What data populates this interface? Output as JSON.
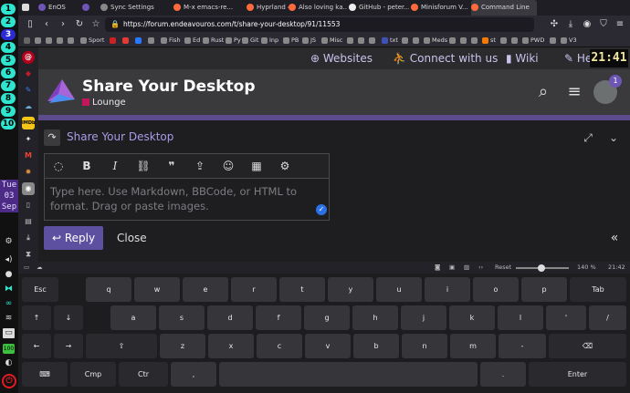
{
  "wm": {
    "workspaces": [
      "1",
      "2",
      "3",
      "4",
      "5",
      "6",
      "7",
      "8",
      "9",
      "10"
    ],
    "active_workspace": "3",
    "clock_lines": [
      "Tue",
      "03",
      "Sep"
    ]
  },
  "browser": {
    "tabs": [
      {
        "label": "EnOS",
        "color": "#6e56b7"
      },
      {
        "label": "",
        "color": "#6e56b7"
      },
      {
        "label": "Sync Settings",
        "color": "#888888"
      },
      {
        "label": "M-x emacs-re...",
        "color": "#ff6a3d"
      },
      {
        "label": "Hyprland 42.0...",
        "color": "#ff6a3d"
      },
      {
        "label": "Also loving ka...",
        "color": "#ff6a3d"
      },
      {
        "label": "GitHub - peter...",
        "color": "#eeeeee"
      },
      {
        "label": "Minisforum V...",
        "color": "#ff6a3d"
      },
      {
        "label": "Command Line",
        "color": "#ff6a3d"
      }
    ],
    "current_tab_index": 8,
    "url": "https://forum.endeavouros.com/t/share-your-desktop/91/11553",
    "bookmarks": [
      {
        "label": "Sport",
        "color": "#888888"
      },
      {
        "label": "",
        "color": "#cc2222"
      },
      {
        "label": "",
        "color": "#e53935"
      },
      {
        "label": "",
        "color": "#2979ff"
      },
      {
        "label": "Fish",
        "color": "#888888"
      },
      {
        "label": "Ed",
        "color": "#888888"
      },
      {
        "label": "Rust",
        "color": "#888888"
      },
      {
        "label": "Py",
        "color": "#888888"
      },
      {
        "label": "Git",
        "color": "#888888"
      },
      {
        "label": "Inp",
        "color": "#888888"
      },
      {
        "label": "PB",
        "color": "#888888"
      },
      {
        "label": "JS",
        "color": "#888888"
      },
      {
        "label": "Misc",
        "color": "#888888"
      },
      {
        "label": "txt",
        "color": "#3f51b5"
      },
      {
        "label": "Meds",
        "color": "#888888"
      },
      {
        "label": "st",
        "color": "#f57c00"
      },
      {
        "label": "PWD",
        "color": "#888888"
      },
      {
        "label": "V3",
        "color": "#888888"
      }
    ],
    "status": {
      "reset": "Reset",
      "zoom": "140 %",
      "time": "21:42"
    }
  },
  "page": {
    "topnav": {
      "websites": "Websites",
      "connect": "Connect with us",
      "wiki": "Wiki",
      "help": "He",
      "time": "21:41"
    },
    "header": {
      "title": "Share Your Desktop",
      "category": "Lounge",
      "notification_count": "1"
    },
    "composer": {
      "title": "Share Your Desktop",
      "placeholder": "Type here. Use Markdown, BBCode, or HTML to format. Drag or paste images.",
      "reply_label": "Reply",
      "close_label": "Close"
    },
    "colors": {
      "accent": "#5e50a0",
      "category": "#c2185b",
      "title_link": "#a99be8"
    }
  },
  "keyboard": {
    "rows": [
      [
        "Esc",
        "q",
        "w",
        "e",
        "r",
        "t",
        "y",
        "u",
        "i",
        "o",
        "p",
        "Tab"
      ],
      [
        "↑",
        "↓",
        "a",
        "s",
        "d",
        "f",
        "g",
        "h",
        "j",
        "k",
        "l",
        "'",
        "/"
      ],
      [
        "←",
        "→",
        "⇧",
        "z",
        "x",
        "c",
        "v",
        "b",
        "n",
        "m",
        "-",
        "⌫"
      ],
      [
        "⌨",
        "Cmp",
        "Ctr",
        ",",
        "",
        ".",
        "Enter"
      ]
    ]
  }
}
